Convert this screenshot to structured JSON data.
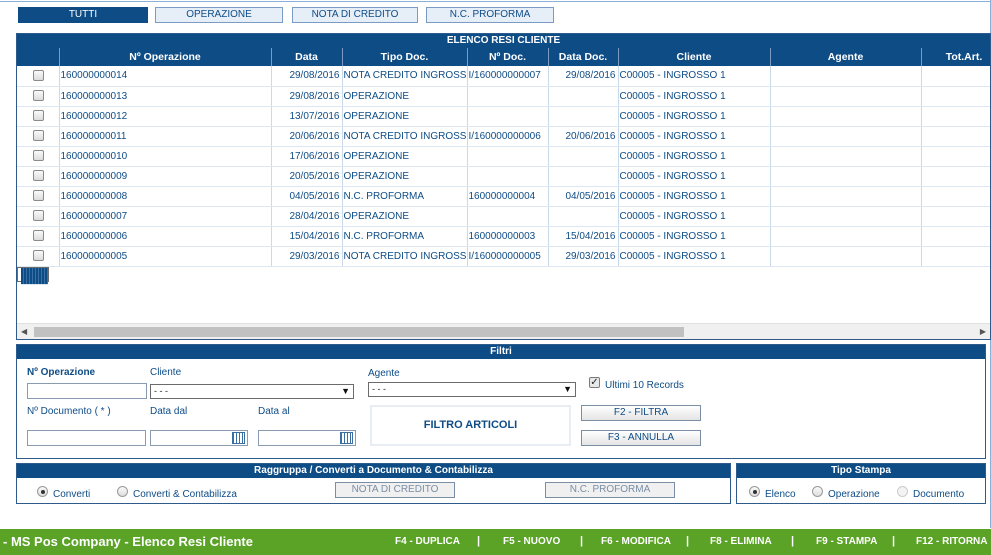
{
  "tabs": [
    "TUTTI",
    "OPERAZIONE",
    "NOTA DI CREDITO",
    "N.C. PROFORMA"
  ],
  "grid": {
    "title": "ELENCO RESI CLIENTE",
    "headers": [
      "Nº Operazione",
      "Data",
      "Tipo Doc.",
      "Nº Doc.",
      "Data Doc.",
      "Cliente",
      "Agente",
      "Tot.Art."
    ],
    "rows": [
      [
        "160000000014",
        "29/08/2016",
        "NOTA CREDITO INGROSSO",
        "I/160000000007",
        "29/08/2016",
        "C00005 - INGROSSO 1"
      ],
      [
        "160000000013",
        "29/08/2016",
        "OPERAZIONE",
        "",
        "",
        "C00005 - INGROSSO 1"
      ],
      [
        "160000000012",
        "13/07/2016",
        "OPERAZIONE",
        "",
        "",
        "C00005 - INGROSSO 1"
      ],
      [
        "160000000011",
        "20/06/2016",
        "NOTA CREDITO INGROSSO",
        "I/160000000006",
        "20/06/2016",
        "C00005 - INGROSSO 1"
      ],
      [
        "160000000010",
        "17/06/2016",
        "OPERAZIONE",
        "",
        "",
        "C00005 - INGROSSO 1"
      ],
      [
        "160000000009",
        "20/05/2016",
        "OPERAZIONE",
        "",
        "",
        "C00005 - INGROSSO 1"
      ],
      [
        "160000000008",
        "04/05/2016",
        "N.C. PROFORMA",
        "160000000004",
        "04/05/2016",
        "C00005 - INGROSSO 1"
      ],
      [
        "160000000007",
        "28/04/2016",
        "OPERAZIONE",
        "",
        "",
        "C00005 - INGROSSO 1"
      ],
      [
        "160000000006",
        "15/04/2016",
        "N.C. PROFORMA",
        "160000000003",
        "15/04/2016",
        "C00005 - INGROSSO 1"
      ],
      [
        "160000000005",
        "29/03/2016",
        "NOTA CREDITO INGROSSO",
        "I/160000000005",
        "29/03/2016",
        "C00005 - INGROSSO 1"
      ]
    ]
  },
  "filtri": {
    "title": "Filtri",
    "num_operazione_label": "Nº Operazione",
    "cliente_label": "Cliente",
    "cliente_value": "- - -",
    "agente_label": "Agente",
    "agente_value": "- - -",
    "ultimi_label": "Ultimi 10 Records",
    "ultimi_checked": true,
    "num_documento_label": "Nº Documento ( * )",
    "data_dal_label": "Data dal",
    "data_al_label": "Data al",
    "filtro_articoli": "FILTRO ARTICOLI",
    "filtra_btn": "F2 - FILTRA",
    "annulla_btn": "F3 - ANNULLA"
  },
  "raggruppa": {
    "title": "Raggruppa / Converti a Documento & Contabilizza",
    "opt1": "Converti",
    "opt2": "Converti & Contabilizza",
    "btn_nota": "NOTA DI CREDITO",
    "btn_nc": "N.C. PROFORMA"
  },
  "tipo_stampa": {
    "title": "Tipo Stampa",
    "opt1": "Elenco",
    "opt2": "Operazione",
    "opt3": "Documento"
  },
  "footer": {
    "title": "- MS Pos Company - Elenco Resi Cliente",
    "keys": [
      "F4 - DUPLICA",
      "F5 - NUOVO",
      "F6 - MODIFICA",
      "F8 - ELIMINA",
      "F9 - STAMPA",
      "F12 - RITORNA"
    ],
    "separator": "|"
  },
  "colors": {
    "header_blue": "#0e4c86",
    "footer_green": "#5aa326"
  }
}
